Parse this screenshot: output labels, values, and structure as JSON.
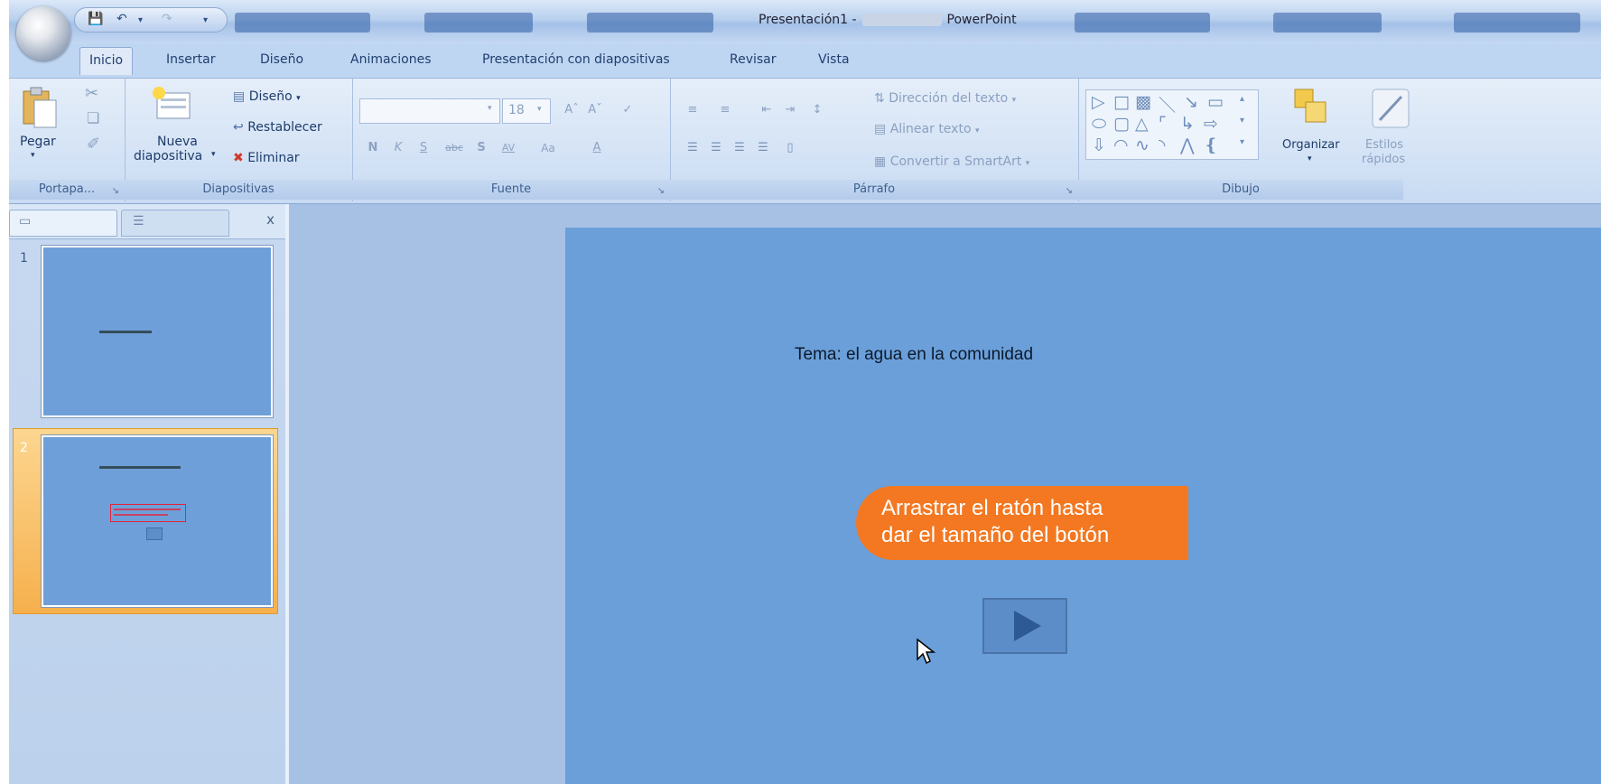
{
  "window": {
    "title_prefix": "Presentación1 -",
    "title_app": "PowerPoint"
  },
  "colors": {
    "accent": "#f37821",
    "slide_bg": "#6a9fda",
    "ribbon": "#d6e4f6"
  },
  "tabs": [
    "Inicio",
    "Insertar",
    "Diseño",
    "Animaciones",
    "Presentación con diapositivas",
    "Revisar",
    "Vista"
  ],
  "ribbon": {
    "portapapeles": {
      "paste": "Pegar",
      "label": "Portapa..."
    },
    "diapositivas": {
      "new1": "Nueva",
      "new2": "diapositiva",
      "diseno": "Diseño",
      "restablecer": "Restablecer",
      "eliminar": "Eliminar",
      "label": "Diapositivas"
    },
    "fuente": {
      "size": "18",
      "label": "Fuente",
      "bold": "N",
      "italic": "K",
      "underline": "S",
      "strike": "abc",
      "shadow": "S",
      "spacing": "AV",
      "case": "Aa",
      "color": "A"
    },
    "parrafo": {
      "direccion": "Dirección del texto",
      "alinear": "Alinear texto",
      "convertir": "Convertir a SmartArt",
      "label": "Párrafo"
    },
    "dibujo": {
      "organizar": "Organizar",
      "estilos1": "Estilos",
      "estilos2": "rápidos",
      "label": "Dibujo"
    }
  },
  "slides_panel": {
    "close": "x",
    "items": [
      {
        "number": "1"
      },
      {
        "number": "2"
      }
    ]
  },
  "slide": {
    "title": "Tema: el agua en la comunidad",
    "callout": [
      "Arrastrar el ratón hasta",
      "dar el tamaño del botón"
    ]
  }
}
